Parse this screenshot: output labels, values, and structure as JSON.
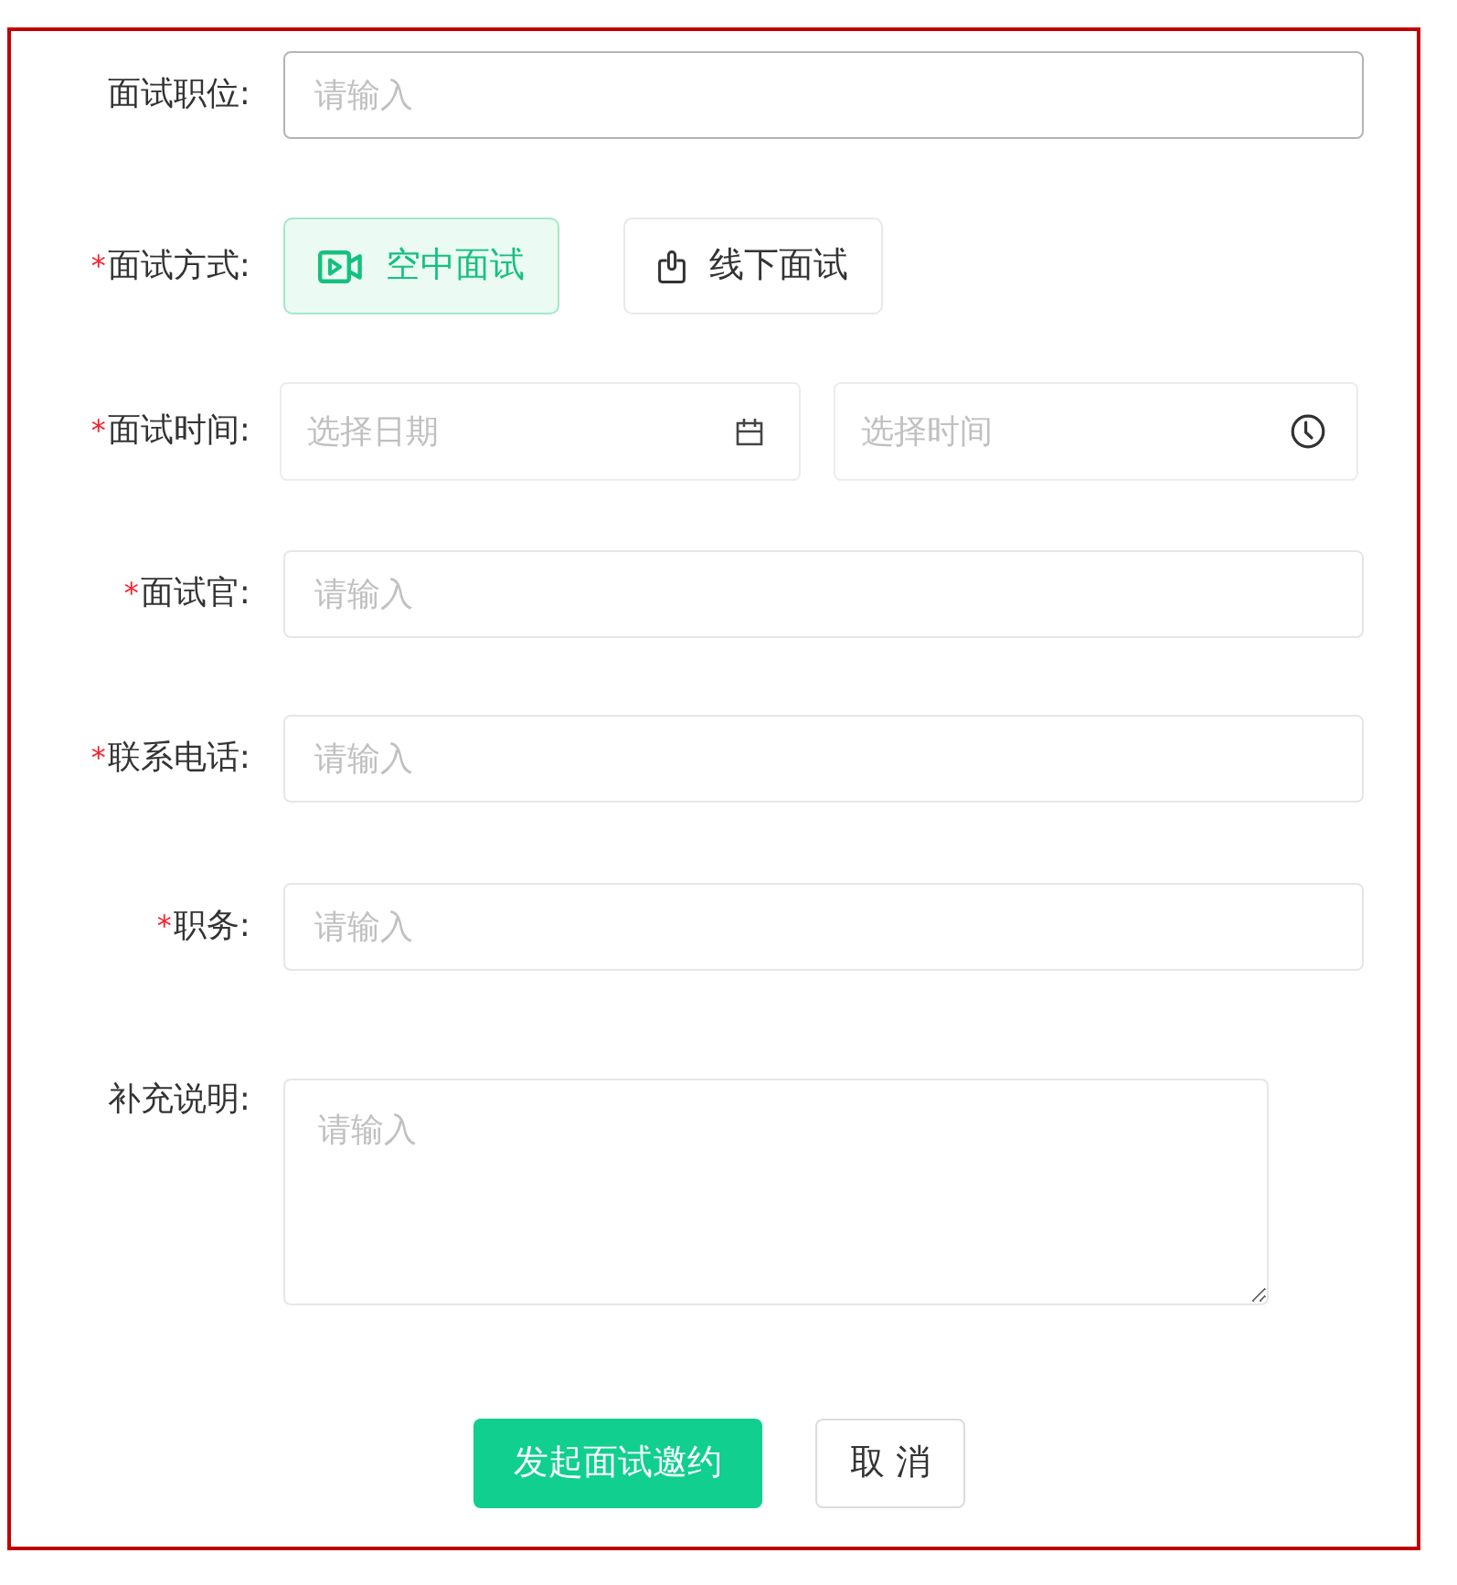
{
  "form": {
    "fields": [
      {
        "kind": "text",
        "label": "面试职位:",
        "placeholder": "请输入",
        "hovered": true
      },
      {
        "kind": "choice",
        "mark": "*",
        "label": "面试方式:",
        "options": [
          {
            "label": "空中面试",
            "selected": true
          },
          {
            "label": "线下面试",
            "selected": false
          }
        ]
      },
      {
        "kind": "datetime",
        "mark": "*",
        "label": "面试时间:",
        "date_placeholder": "选择日期",
        "time_placeholder": "选择时间"
      },
      {
        "kind": "text",
        "mark": "*",
        "label": "面试官:",
        "placeholder": "请输入",
        "hovered": false
      },
      {
        "kind": "text",
        "mark": "*",
        "label": "联系电话:",
        "placeholder": "请输入",
        "hovered": false
      },
      {
        "kind": "text",
        "mark": "*",
        "label": "职务:",
        "placeholder": "请输入",
        "hovered": false
      },
      {
        "kind": "textarea",
        "label": "补充说明:",
        "placeholder": "请输入"
      }
    ]
  },
  "actions": [
    {
      "kind": "primary",
      "label": "发起面试邀约"
    },
    {
      "kind": "secondary",
      "label": "取 消"
    }
  ]
}
